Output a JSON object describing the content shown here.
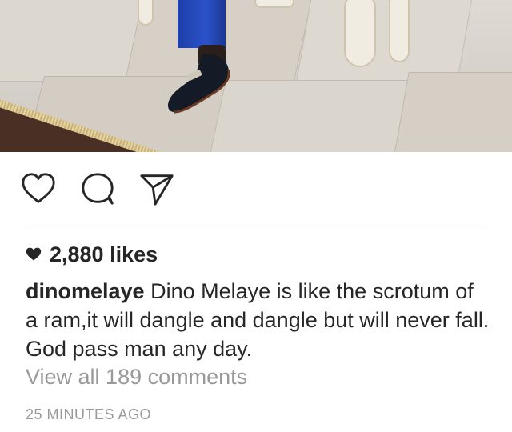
{
  "post": {
    "photo": {
      "alt_subject": "shoe-on-marble-floor"
    },
    "actions": {
      "like_icon": "heart-outline-icon",
      "comment_icon": "comment-bubble-icon",
      "share_icon": "paper-plane-icon"
    },
    "likes": {
      "icon": "heart-filled-icon",
      "text": "2,880 likes"
    },
    "caption": {
      "username": "dinomelaye",
      "text": "Dino Melaye is like the scrotum of a ram,it will dangle and dangle but will never fall. God pass man any day."
    },
    "comments_link": "View all 189 comments",
    "timestamp": "25 MINUTES AGO"
  },
  "colors": {
    "text_primary": "#262626",
    "text_secondary": "#999999",
    "divider": "#e1e1e1",
    "background": "#ffffff"
  }
}
